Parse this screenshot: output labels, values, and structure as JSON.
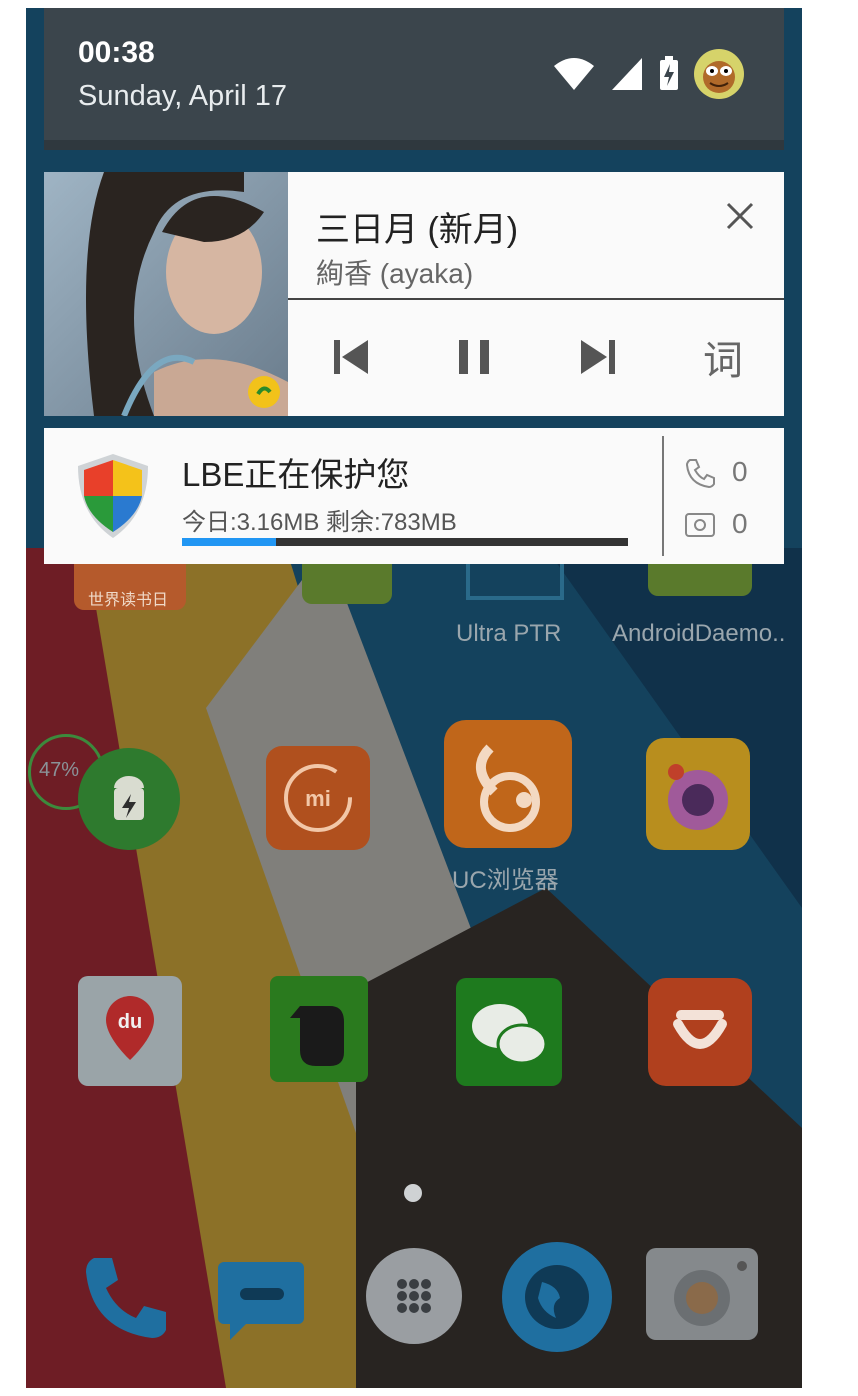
{
  "status": {
    "time": "00:38",
    "date": "Sunday, April 17"
  },
  "media": {
    "title": "三日月 (新月)",
    "artist": "絢香 (ayaka)",
    "lyrics_label": "词"
  },
  "lbe": {
    "title": "LBE正在保护您",
    "stats": "今日:3.16MB 剩余:783MB",
    "data_used_fraction": 0.21,
    "calls_count": "0",
    "messages_count": "0"
  },
  "home": {
    "apps": {
      "world_reading_day_badge": "世界读书日",
      "ultra_ptr": "Ultra PTR",
      "android_daemon": "AndroidDaemo..",
      "battery_widget_percent": "47%",
      "uc_browser": "UC浏览器"
    }
  },
  "colors": {
    "accent_blue": "#2196f3",
    "header_bg": "#3b454c"
  }
}
